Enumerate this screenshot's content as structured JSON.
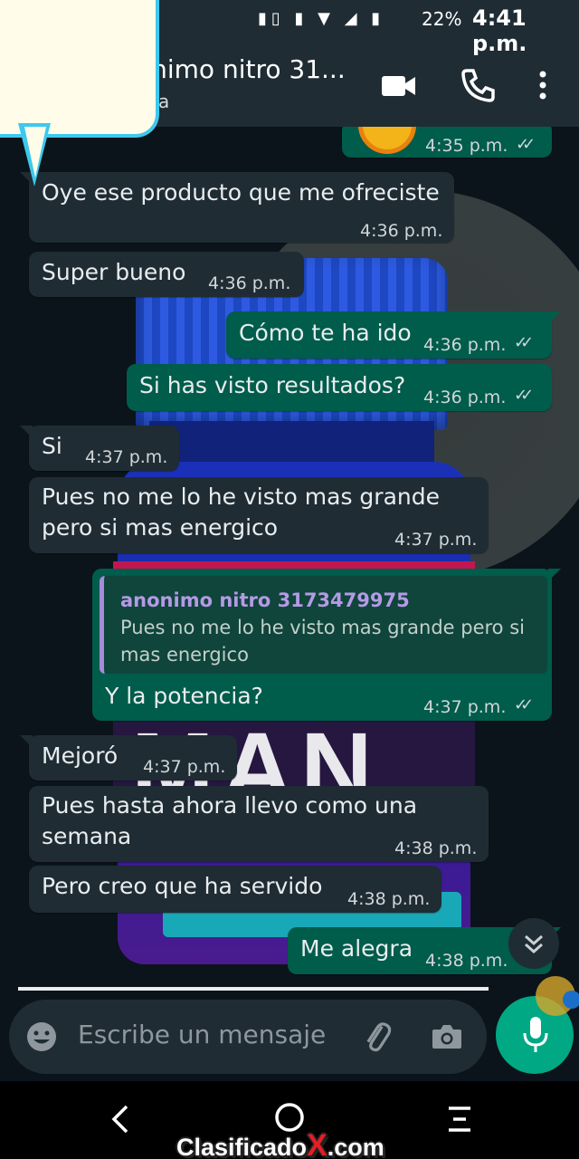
{
  "status_bar": {
    "battery": "22%",
    "time": "4:41 p.m."
  },
  "header": {
    "contact_name": "onimo nitro 31...",
    "status": "nea"
  },
  "messages": [
    {
      "time": "4:35 p.m."
    },
    {
      "text": "Oye ese producto que me ofreciste",
      "time": "4:36 p.m."
    },
    {
      "text": "Super bueno",
      "time": "4:36 p.m."
    },
    {
      "text": "Cómo te ha ido",
      "time": "4:36 p.m."
    },
    {
      "text": "Si has visto resultados?",
      "time": "4:36 p.m."
    },
    {
      "text": "Si",
      "time": "4:37 p.m."
    },
    {
      "text_line1": "Pues no me lo he visto mas grande",
      "text_line2": "pero si mas energico",
      "time": "4:37 p.m."
    },
    {
      "quote_name": "anonimo nitro 3173479975",
      "quote_text": "Pues no me lo he visto mas grande pero si mas energico",
      "text": "Y la potencia?",
      "time": "4:37 p.m."
    },
    {
      "text": "Mejoró",
      "time": "4:37 p.m."
    },
    {
      "text_line1": "Pues hasta ahora llevo como una",
      "text_line2": "semana",
      "time": "4:38 p.m."
    },
    {
      "text": "Pero creo que ha servido",
      "time": "4:38 p.m."
    },
    {
      "text": "Me alegra",
      "time": "4:38 p.m."
    }
  ],
  "input": {
    "placeholder": "Escribe un mensaje"
  },
  "background_label": "MAN",
  "watermark": {
    "part1": "Clasificado",
    "x": "X",
    "part2": ".com"
  },
  "colors": {
    "incoming": "#1f2c34",
    "outgoing": "#005c4b",
    "accent": "#00a884",
    "callout_border": "#3ec8ee"
  }
}
